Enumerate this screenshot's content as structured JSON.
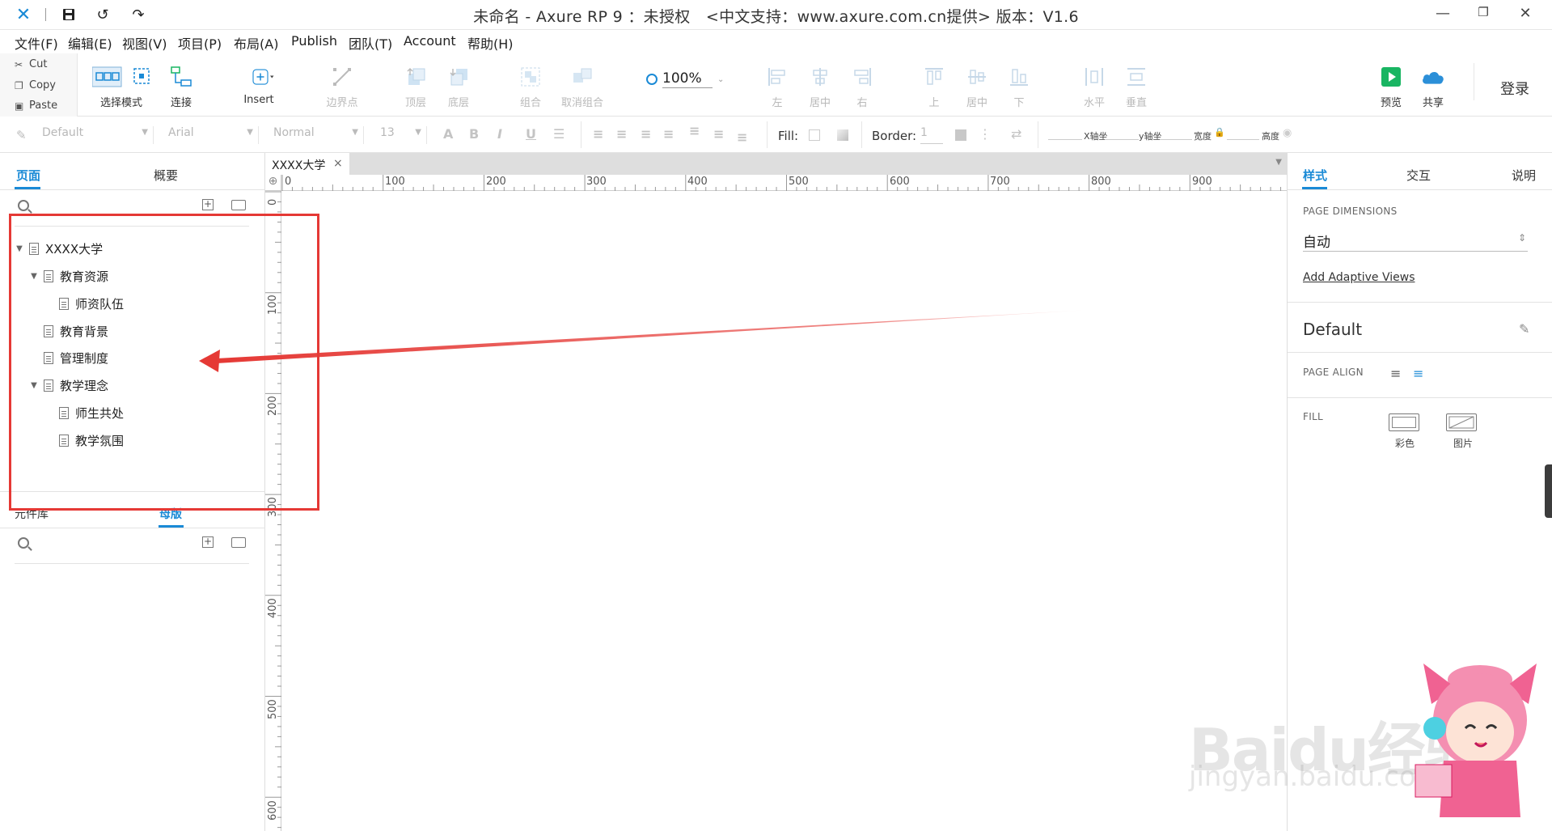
{
  "titlebar": {
    "title": "未命名 - Axure RP 9 ：未授权　<中文支持：www.axure.com.cn提供> 版本：V1.6",
    "min": "—",
    "max": "❐",
    "close": "✕"
  },
  "menu": [
    "文件(F)",
    "编辑(E)",
    "视图(V)",
    "项目(P)",
    "布局(A)",
    "Publish",
    "团队(T)",
    "Account",
    "帮助(H)"
  ],
  "clipboard": {
    "cut": "Cut",
    "copy": "Copy",
    "paste": "Paste"
  },
  "tools": {
    "select_mode": "选择模式",
    "connect": "连接",
    "insert": "Insert",
    "points": "边界点",
    "top_layer": "顶层",
    "bottom_layer": "底层",
    "group": "组合",
    "ungroup": "取消组合",
    "zoom": "100%",
    "align_left": "左",
    "align_center": "居中",
    "align_right": "右",
    "align_top": "上",
    "align_middle": "居中",
    "align_bottom": "下",
    "distribute_h": "水平",
    "distribute_v": "垂直",
    "preview": "预览",
    "share": "共享",
    "login": "登录"
  },
  "format": {
    "style": "Default",
    "font": "Arial",
    "weight": "Normal",
    "size": "13",
    "fill_label": "Fill:",
    "border_label": "Border:",
    "border_value": "1",
    "x_label": "X轴坐",
    "y_label": "y轴坐",
    "w_label": "宽度",
    "h_label": "高度"
  },
  "left": {
    "tab_pages": "页面",
    "tab_outline": "概要",
    "tree": [
      {
        "label": "XXXX大学",
        "level": 0,
        "expanded": true
      },
      {
        "label": "教育资源",
        "level": 1,
        "expanded": true
      },
      {
        "label": "师资队伍",
        "level": 2
      },
      {
        "label": "教育背景",
        "level": 1
      },
      {
        "label": "管理制度",
        "level": 1
      },
      {
        "label": "教学理念",
        "level": 1,
        "expanded": true
      },
      {
        "label": "师生共处",
        "level": 2
      },
      {
        "label": "教学氛围",
        "level": 2
      }
    ],
    "tab_library": "元件库",
    "tab_masters": "母版"
  },
  "doc_tab": {
    "label": "XXXX大学",
    "close": "×"
  },
  "ruler": {
    "h": [
      "0",
      "100",
      "200",
      "300",
      "400",
      "500",
      "600",
      "700",
      "800",
      "900"
    ],
    "v": [
      "0",
      "100",
      "200",
      "300",
      "400",
      "500",
      "600"
    ]
  },
  "right": {
    "tab_style": "样式",
    "tab_interact": "交互",
    "tab_notes": "说明",
    "page_dimensions_label": "PAGE DIMENSIONS",
    "page_dimensions_value": "自动",
    "add_adaptive": "Add Adaptive Views",
    "style_name": "Default",
    "page_align_label": "PAGE ALIGN",
    "fill_label": "FILL",
    "fill_color": "彩色",
    "fill_image": "图片"
  },
  "watermark": {
    "brand": "Baidu经验",
    "url": "jingyan.baidu.com"
  },
  "colors": {
    "accent": "#1a8ad6",
    "annotation": "#e53935",
    "preview_green": "#19b562"
  }
}
